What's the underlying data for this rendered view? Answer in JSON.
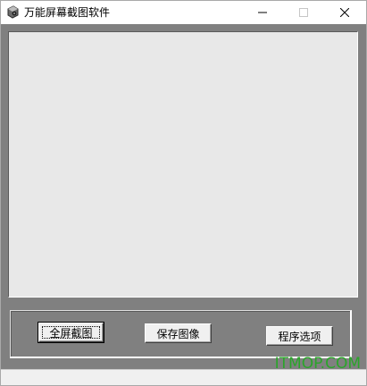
{
  "window": {
    "title": "万能屏幕截图软件",
    "app_icon": "camera-cube-icon"
  },
  "caption_buttons": {
    "minimize_icon": "minimize-icon",
    "maximize_icon": "maximize-icon",
    "close_icon": "close-icon"
  },
  "toolbar": {
    "fullscreen_label": "全屏截图",
    "save_label": "保存图像",
    "options_label": "程序选项"
  },
  "watermark": {
    "text": "ITMOP.COM",
    "color": "#2aa52a"
  },
  "colors": {
    "client_bg": "#808080",
    "preview_bg": "#e8e8e8"
  }
}
